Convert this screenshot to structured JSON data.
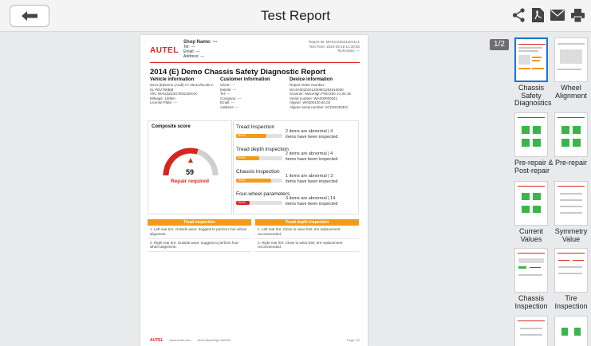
{
  "header": {
    "title": "Test Report"
  },
  "viewer": {
    "page_indicator": "1/2"
  },
  "report": {
    "logo": "AUTEL",
    "shop_name_label": "Shop Name: ---",
    "shop_tel": "Tel: ---",
    "shop_email": "Email: ---",
    "shop_address": "Address: ---",
    "report_id": "Report ID: MAXIAS20211014A1",
    "test_time": "Test Time: 2024-03-18 14:30:50",
    "tech_user": "Technician: ---",
    "title": "2014 (E) Demo Chassis Safety Diagnostic Report",
    "vehicle": {
      "heading": "Vehicle information",
      "lines": [
        "2014 (E)Demo (Audi) A7 2011c/ELXB 2.",
        "0L PBV706BM",
        "VIN: WAUZZZ4G7E9130XXX",
        "Mileage: 100km",
        "License Plate: ---"
      ]
    },
    "customer": {
      "heading": "Customer information",
      "lines": [
        "Client: ---",
        "Mobile: ---",
        "Tel: ---",
        "Company: ---",
        "Email: ---",
        "Address: ---"
      ]
    },
    "device": {
      "heading": "Device information",
      "lines": [
        "Repair Order Number:",
        "WA3A0020241200901281810060",
        "Scanner: MaxiAlign PWA200 V1.00.16",
        "Serial number: WA000000341",
        "Aligner: WA000100.60.02",
        "Aligner serial number: 0CDSI240301"
      ]
    },
    "composite": {
      "heading": "Composite score",
      "score": "59",
      "status": "Repair required",
      "score_value": 59
    },
    "metrics": [
      {
        "label": "Tread Inspection",
        "bar_text": "66/100",
        "value": 66,
        "color": "#f39b18",
        "result_line1": "2 items are abnormal | 4",
        "result_line2": "items have been inspected"
      },
      {
        "label": "Tread depth inspection",
        "bar_text": "50/100",
        "value": 50,
        "color": "#f39b18",
        "result_line1": "2 items are abnormal | 4",
        "result_line2": "items have been inspected"
      },
      {
        "label": "Chassis Inspection",
        "bar_text": "75/100",
        "value": 75,
        "color": "#f39b18",
        "result_line1": "1 items are abnormal | 3",
        "result_line2": "items have been inspected"
      },
      {
        "label": "Four-wheel parameters",
        "bar_text": "29/100",
        "value": 29,
        "color": "#d7261f",
        "result_line1": "3 items are abnormal | 14",
        "result_line2": "items have been inspected"
      }
    ],
    "tread_table": {
      "heading": "Tread inspection",
      "rows": [
        "1. Left rear tire: Outside wear. Suggest to perform four-wheel alignment.",
        "2. Right rear tire: Outside wear. Suggest to perform four-wheel alignment."
      ]
    },
    "depth_table": {
      "heading": "Tread depth inspection",
      "rows": [
        "1. Left rear tire: Close to wear limit, tire replacement recommended.",
        "2. Right rear tire: Close to wear limit, tire replacement recommended."
      ]
    },
    "footer": {
      "logo": "AUTEL",
      "site": "www.autel.com",
      "product": "Autel MaxiAlign WA200",
      "page": "Page 1/2"
    }
  },
  "thumbnails": [
    {
      "label1": "Chassis",
      "label2": "Safety",
      "label3": "Diagnostics",
      "selected": true
    },
    {
      "label1": "Wheel",
      "label2": "Alignment",
      "label3": ""
    },
    {
      "label1": "Pre-repair &",
      "label2": "Post-repair",
      "label3": ""
    },
    {
      "label1": "Pre-repair",
      "label2": "",
      "label3": ""
    },
    {
      "label1": "Current",
      "label2": "Values",
      "label3": ""
    },
    {
      "label1": "Symmetry",
      "label2": "Value",
      "label3": ""
    },
    {
      "label1": "Chassis",
      "label2": "Inspection",
      "label3": ""
    },
    {
      "label1": "Tire",
      "label2": "Inspection",
      "label3": ""
    },
    {
      "label1": "",
      "label2": "",
      "label3": ""
    },
    {
      "label1": "",
      "label2": "",
      "label3": ""
    }
  ],
  "colors": {
    "accent": "#d7261f",
    "orange": "#f39b18",
    "selected_border": "#1976d2"
  },
  "icons": {
    "back": "arrow-left-icon",
    "share": "share-icon",
    "pdf": "pdf-icon",
    "email": "email-icon",
    "print": "print-icon"
  }
}
